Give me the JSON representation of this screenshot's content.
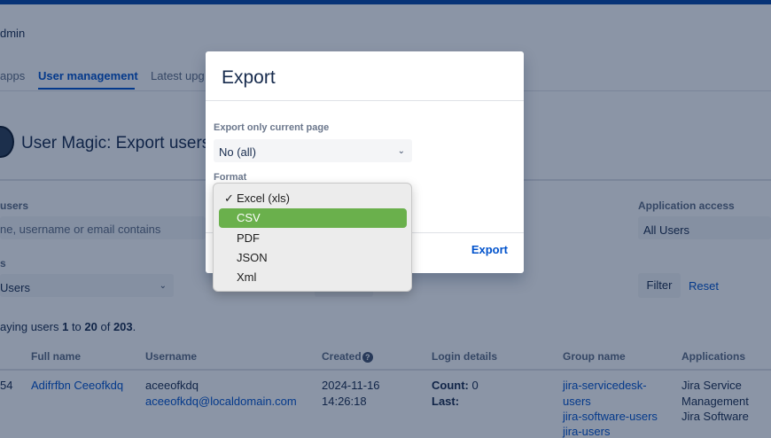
{
  "header": {
    "admin_label": "dmin"
  },
  "nav": {
    "tabs": [
      {
        "label": "apps"
      },
      {
        "label": "User management"
      },
      {
        "label": "Latest upg"
      }
    ]
  },
  "page": {
    "title": "User Magic: Export users"
  },
  "filters": {
    "users_label": "users",
    "users_placeholder": "ne, username or email contains",
    "group_label": "s",
    "group_value": "Users",
    "app_access_label": "Application access",
    "app_access_value": "All Users",
    "filter_button": "Filter",
    "reset_link": "Reset"
  },
  "summary": {
    "prefix": "aying users ",
    "from": "1",
    "to_word": " to ",
    "to": "20",
    "of_word": " of ",
    "total": "203",
    "suffix": "."
  },
  "table": {
    "headers": [
      "Full name",
      "Username",
      "Created",
      "Login details",
      "Group name",
      "Applications"
    ],
    "row": {
      "id": "54",
      "full_name": "Adifrfbn Ceeofkdq",
      "username": "aceeofkdq",
      "email": "aceeofkdq@localdomain.com",
      "created_date": "2024-11-16",
      "created_time": "14:26:18",
      "count_label": "Count:",
      "count_value": "0",
      "last_label": "Last:",
      "groups": [
        "jira-servicedesk-",
        "users",
        "jira-software-users",
        "jira-users"
      ],
      "applications": [
        "Jira Service",
        "Management",
        "Jira Software"
      ]
    }
  },
  "modal": {
    "title": "Export",
    "export_only_label": "Export only current page",
    "export_only_value": "No (all)",
    "format_label": "Format",
    "export_button": "Export"
  },
  "format_dropdown": {
    "options": [
      "Excel (xls)",
      "CSV",
      "PDF",
      "JSON",
      "Xml"
    ],
    "checked": "Excel (xls)",
    "highlighted": "CSV",
    "check_mark": "✓"
  },
  "colors": {
    "link": "#0052cc",
    "topbar": "#0747a6",
    "highlight": "#6ab04c"
  }
}
